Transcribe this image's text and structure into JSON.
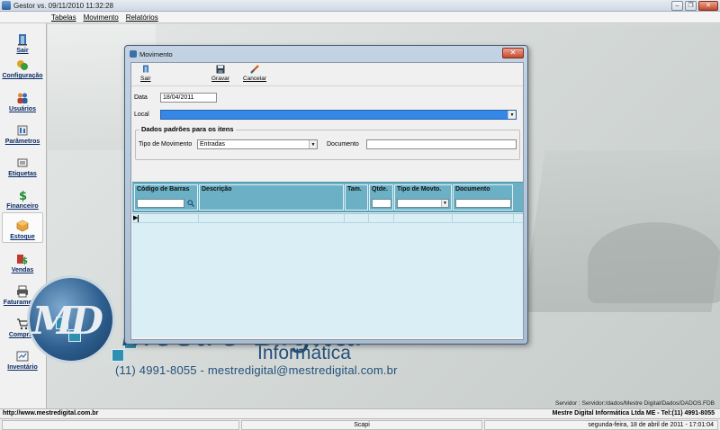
{
  "app": {
    "title": "Gestor vs. 09/11/2010 11:32:28",
    "window_controls": {
      "minimize": "–",
      "restore": "❐",
      "close": "✕"
    }
  },
  "menu": {
    "items": [
      "Tabelas",
      "Movimento",
      "Relatórios"
    ]
  },
  "sidebar": {
    "items": [
      {
        "label": "Sair",
        "icon": "exit-icon"
      },
      {
        "label": "Configuração",
        "icon": "config-icon"
      },
      {
        "label": "Usuários",
        "icon": "users-icon"
      },
      {
        "label": "Parâmetros",
        "icon": "parameters-icon"
      },
      {
        "label": "Etiquetas",
        "icon": "labels-icon"
      },
      {
        "label": "Financeiro",
        "icon": "dollar-icon"
      },
      {
        "label": "Estoque",
        "icon": "box-icon"
      },
      {
        "label": "Vendas",
        "icon": "sales-icon"
      },
      {
        "label": "Faturamento",
        "icon": "printer-icon"
      },
      {
        "label": "Compras",
        "icon": "cart-icon"
      },
      {
        "label": "Inventário",
        "icon": "inventory-icon"
      }
    ],
    "active": "Estoque"
  },
  "dialog": {
    "title": "Movimento",
    "close": "✕",
    "toolbar": {
      "sair": {
        "label": "Sair",
        "icon": "exit-icon"
      },
      "gravar": {
        "label": "Gravar",
        "icon": "save-icon"
      },
      "cancelar": {
        "label": "Cancelar",
        "icon": "cancel-icon"
      }
    },
    "data_label": "Data",
    "data_value": "18/04/2011",
    "local_label": "Local",
    "local_value": "",
    "group_title": "Dados padrões para os itens",
    "tipo_label": "Tipo de Movimento",
    "tipo_value": "Entradas",
    "documento_label": "Documento",
    "documento_value": "",
    "grid": {
      "columns": [
        "Código de Barras",
        "Descrição",
        "Tam.",
        "Qtde.",
        "Tipo de Movto.",
        "Documento"
      ],
      "row_pointer": "▶"
    }
  },
  "branding": {
    "logo_letters": "MD",
    "company": "Mestre Digital",
    "subtitle": "Informática",
    "contact": "(11) 4991-8055 - mestredigital@mestredigital.com.br"
  },
  "server_info": "Servidor : Servidor:/dados/Mestre Digital/Dados/DADOS.FDB",
  "status": {
    "url": "http://www.mestredigital.com.br",
    "company_line": "Mestre Digital Informática Ltda ME - Tel:(11) 4991-8055",
    "user": "Scapi",
    "datetime": "segunda-feira, 18 de abril de 2011 - 17:01:04"
  },
  "colors": {
    "grid_header": "#6bb0c5",
    "grid_body": "#d9eef5",
    "local_combo": "#3388e8",
    "brand_blue": "#24507a"
  }
}
